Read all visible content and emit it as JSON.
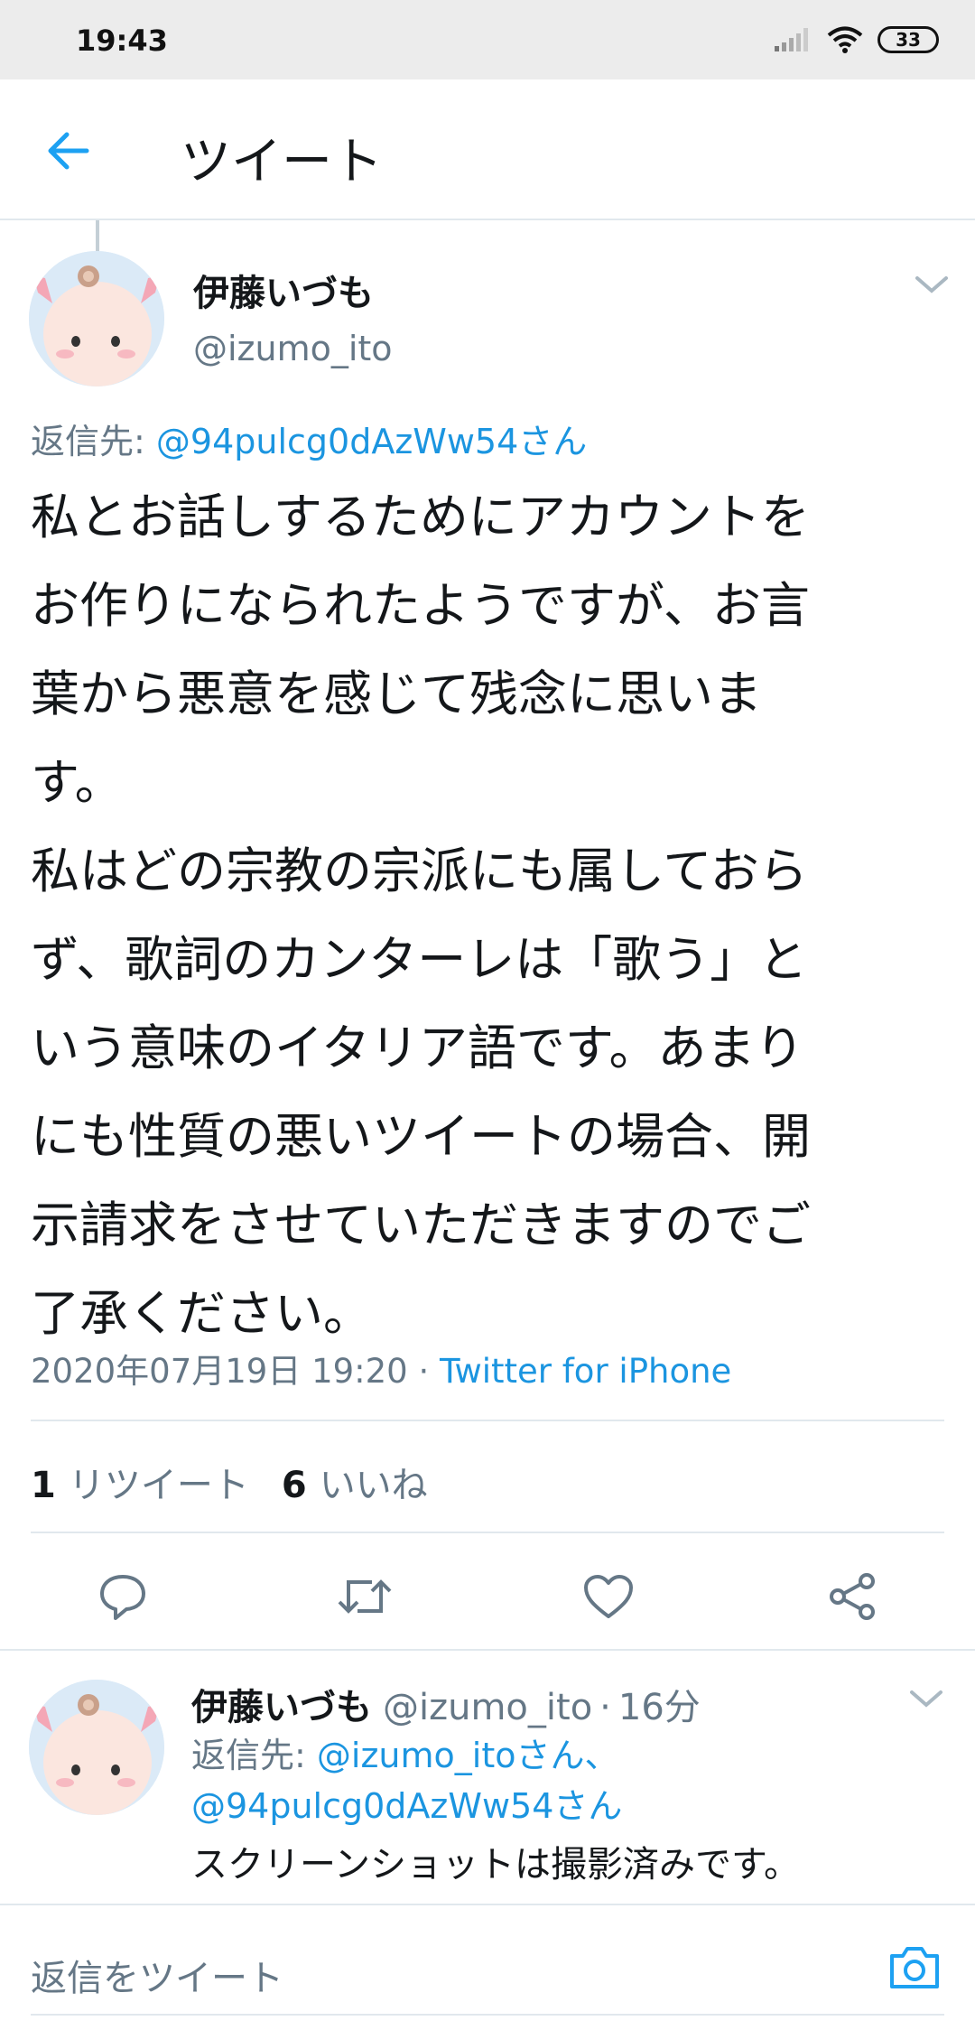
{
  "status_bar": {
    "time": "19:43",
    "battery": "33"
  },
  "header": {
    "title": "ツイート"
  },
  "tweet": {
    "author_name": "伊藤いづも",
    "author_handle": "@izumo_ito",
    "reply_to_label": "返信先:",
    "reply_to_mention": "@94pulcg0dAzWw54さん",
    "text": "私とお話しするためにアカウントを\nお作りになられたようですが、お言\n葉から悪意を感じて残念に思いま\nす。\n私はどの宗教の宗派にも属しておら\nず、歌詞のカンターレは「歌う」と\nいう意味のイタリア語です。あまり\nにも性質の悪いツイートの場合、開\n示請求をさせていただきますのでご\n了承ください。",
    "timestamp": "2020年07月19日 19:20",
    "separator": "·",
    "client": "Twitter for iPhone",
    "retweet_count": "1",
    "retweet_label": "リツイート",
    "like_count": "6",
    "like_label": "いいね"
  },
  "reply": {
    "author_name": "伊藤いづも",
    "author_handle": "@izumo_ito",
    "separator": "·",
    "time": "16分",
    "reply_to_label": "返信先:",
    "reply_to_mention_1": "@izumo_itoさん、",
    "reply_to_mention_2": "@94pulcg0dAzWw54さん",
    "text": "スクリーンショットは撮影済みです。"
  },
  "compose": {
    "placeholder": "返信をツイート"
  },
  "colors": {
    "accent": "#1da1f2",
    "link": "#1b95e0",
    "secondary_text": "#657786",
    "divider": "#e1e8ed",
    "status_bar": "#ececec"
  }
}
